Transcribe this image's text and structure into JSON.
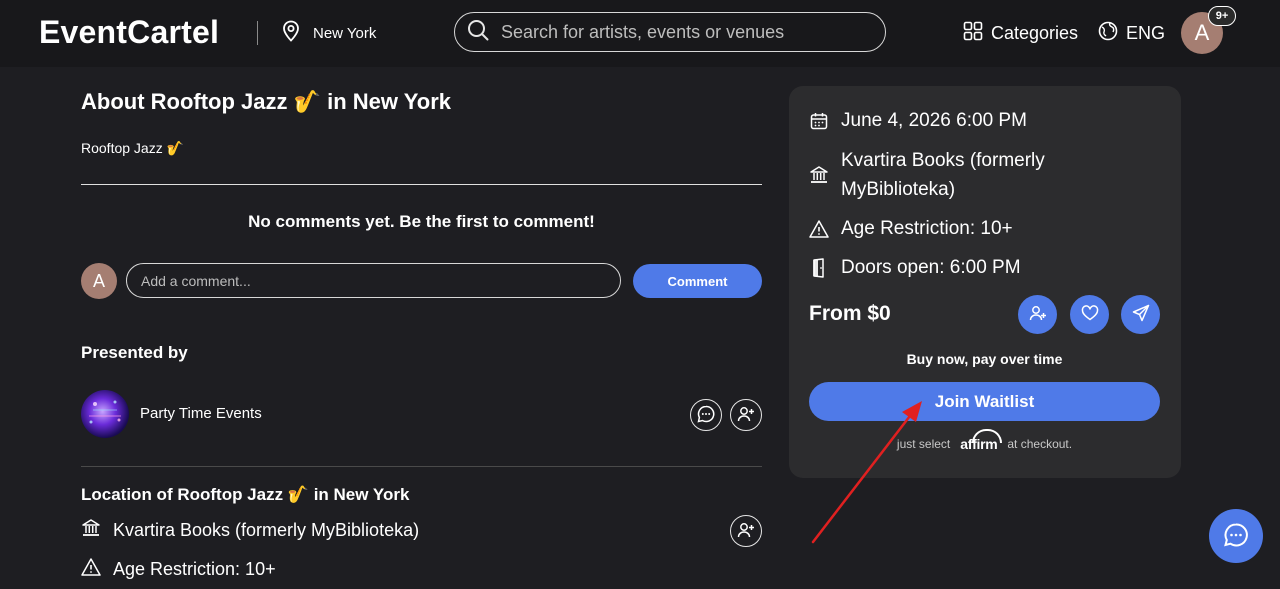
{
  "header": {
    "logo": "EventCartel",
    "location": "New York",
    "search_placeholder": "Search for artists, events or venues",
    "categories_label": "Categories",
    "language_label": "ENG",
    "avatar_initial": "A",
    "notification_badge": "9+"
  },
  "about": {
    "title": "About Rooftop Jazz 🎷 in New York",
    "subtitle": "Rooftop Jazz 🎷"
  },
  "comments": {
    "empty_message": "No comments yet. Be the first to comment!",
    "avatar_initial": "A",
    "input_placeholder": "Add a comment...",
    "button_label": "Comment"
  },
  "presented": {
    "heading": "Presented by",
    "organizer_name": "Party Time Events"
  },
  "location_section": {
    "title": "Location of Rooftop Jazz 🎷 in New York",
    "venue": "Kvartira Books (formerly MyBiblioteka)",
    "age_restriction": "Age Restriction: 10+"
  },
  "event_card": {
    "date_time": "June 4, 2026 6:00 PM",
    "venue_line1": "Kvartira Books (formerly",
    "venue_line2": "MyBiblioteka)",
    "age_restriction": "Age Restriction: 10+",
    "doors_open": "Doors open: 6:00 PM",
    "price": "From $0",
    "bnpl_text": "Buy now, pay over time",
    "join_button": "Join Waitlist",
    "affirm_prefix": "just select",
    "affirm_brand": "affirm",
    "affirm_suffix": "at checkout."
  },
  "colors": {
    "accent": "#4f7ae8",
    "background": "#1e1e22",
    "card": "#2c2c2e",
    "annotation_arrow": "#e02020"
  }
}
